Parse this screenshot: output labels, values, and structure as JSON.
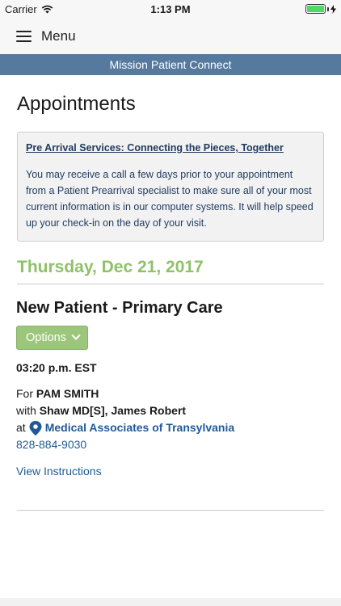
{
  "status_bar": {
    "carrier": "Carrier",
    "time": "1:13 PM",
    "battery_level": 1.0,
    "battery_color": "#4cd964"
  },
  "menu": {
    "label": "Menu",
    "icon": "hamburger-icon"
  },
  "banner": {
    "text": "Mission Patient Connect",
    "color": "#557a9e"
  },
  "page": {
    "title": "Appointments"
  },
  "notice": {
    "title": "Pre Arrival Services:  Connecting the Pieces, Together ",
    "body": "You may receive a call a few days prior to your appointment from a Patient Prearrival specialist to make sure all of your most current information is in our computer systems. It will help speed up your check-in on the day of your visit."
  },
  "appointment_day": {
    "date": "Thursday, Dec 21, 2017",
    "accent_color": "#8fc16a"
  },
  "appointment": {
    "title": "New Patient - Primary Care",
    "options_label": "Options",
    "time": "03:20 p.m. EST",
    "for_prefix": "For",
    "patient": "PAM SMITH",
    "with_prefix": "with",
    "provider": "Shaw MD[S], James Robert",
    "at_prefix": "at",
    "location": "Medical Associates of Transylvania",
    "phone": "828-884-9030",
    "view_instructions": "View Instructions",
    "link_color": "#1f5a96"
  }
}
